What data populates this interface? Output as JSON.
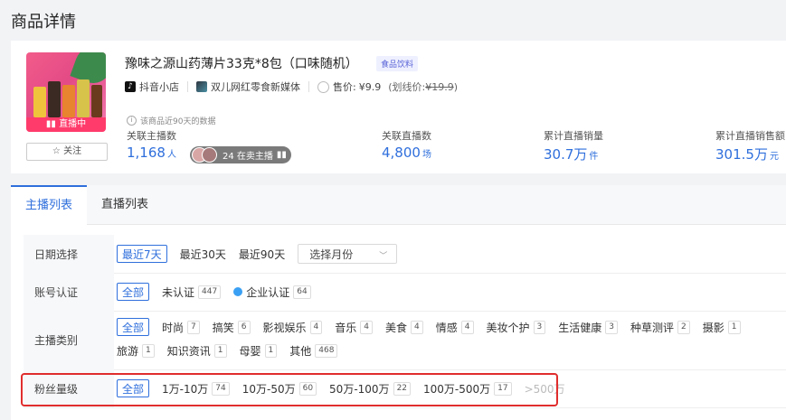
{
  "page_title": "商品详情",
  "product": {
    "title": "豫味之源山药薄片33克*8包（口味随机）",
    "tag": "食品饮料",
    "live_badge": "直播中",
    "follow_label": "关注",
    "platform": "抖音小店",
    "shop": "双儿网红零食新媒体",
    "price_label": "售价:",
    "price": "¥9.9",
    "original_price_label": "(划线价:",
    "original_price": "¥19.9",
    "original_price_close": ")",
    "data_note": "该商品近90天的数据"
  },
  "stats": [
    {
      "label": "关联主播数",
      "value": "1,168",
      "unit": "人"
    },
    {
      "label": "关联直播数",
      "value": "4,800",
      "unit": "场"
    },
    {
      "label": "累计直播销量",
      "value": "30.7万",
      "unit": "件"
    },
    {
      "label": "累计直播销售额",
      "value": "301.5万",
      "unit": "元"
    }
  ],
  "anchor_pill": "24 在卖主播",
  "tabs": [
    {
      "label": "主播列表",
      "active": true
    },
    {
      "label": "直播列表",
      "active": false
    }
  ],
  "filters": {
    "date": {
      "label": "日期选择",
      "options": [
        "最近7天",
        "最近30天",
        "最近90天"
      ],
      "month_placeholder": "选择月份"
    },
    "account": {
      "label": "账号认证",
      "options": [
        {
          "label": "全部"
        },
        {
          "label": "未认证",
          "count": "447"
        },
        {
          "label": "企业认证",
          "count": "64"
        }
      ]
    },
    "category": {
      "label": "主播类别",
      "options": [
        {
          "label": "全部"
        },
        {
          "label": "时尚",
          "count": "7"
        },
        {
          "label": "搞笑",
          "count": "6"
        },
        {
          "label": "影视娱乐",
          "count": "4"
        },
        {
          "label": "音乐",
          "count": "4"
        },
        {
          "label": "美食",
          "count": "4"
        },
        {
          "label": "情感",
          "count": "4"
        },
        {
          "label": "美妆个护",
          "count": "3"
        },
        {
          "label": "生活健康",
          "count": "3"
        },
        {
          "label": "种草测评",
          "count": "2"
        },
        {
          "label": "摄影",
          "count": "1"
        },
        {
          "label": "旅游",
          "count": "1"
        },
        {
          "label": "知识资讯",
          "count": "1"
        },
        {
          "label": "母婴",
          "count": "1"
        },
        {
          "label": "其他",
          "count": "468"
        }
      ]
    },
    "fans": {
      "label": "粉丝量级",
      "options": [
        {
          "label": "全部"
        },
        {
          "label": "1万-10万",
          "count": "74"
        },
        {
          "label": "10万-50万",
          "count": "60"
        },
        {
          "label": "50万-100万",
          "count": "22"
        },
        {
          "label": "100万-500万",
          "count": "17"
        },
        {
          "label": ">500万"
        }
      ]
    }
  },
  "colors": {
    "accent": "#2f6fdc",
    "live": "#ff3b6b",
    "highlight": "#e02d2d"
  }
}
